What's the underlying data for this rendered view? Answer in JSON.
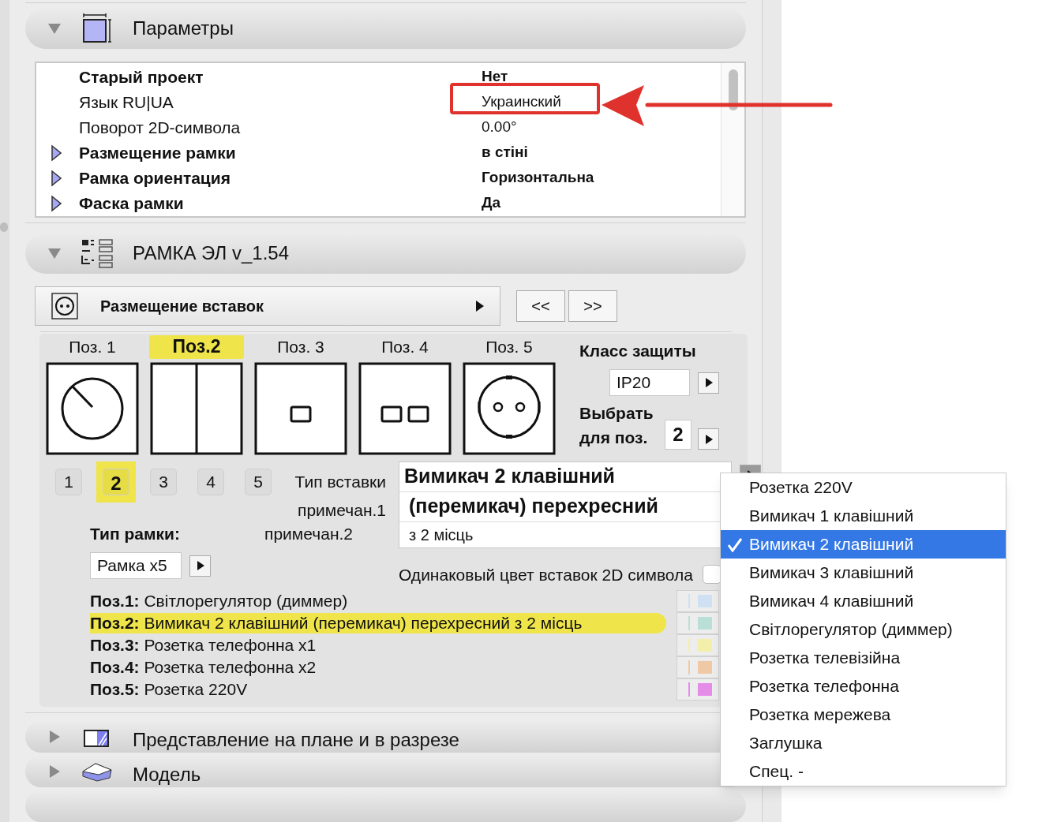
{
  "parameters_panel": {
    "title": "Параметры",
    "expanded": true,
    "rows": [
      {
        "label": "Старый проект",
        "value": "Нет",
        "bold": true,
        "expandable": false,
        "annotated": false
      },
      {
        "label": "Язык RU|UA",
        "value": "Украинский",
        "bold": false,
        "expandable": false,
        "annotated": true
      },
      {
        "label": "Поворот 2D-символа",
        "value": "0.00°",
        "bold": false,
        "expandable": false,
        "annotated": false
      },
      {
        "label": "Размещение рамки",
        "value": "в стіні",
        "bold": true,
        "expandable": true,
        "annotated": false
      },
      {
        "label": "Рамка ориентация",
        "value": "Горизонтальна",
        "bold": true,
        "expandable": true,
        "annotated": false
      },
      {
        "label": "Фаска рамки",
        "value": "Да",
        "bold": true,
        "expandable": true,
        "annotated": false
      }
    ]
  },
  "frame_panel": {
    "title": "РАМКА ЭЛ v_1.54",
    "expanded": true,
    "page_selector": {
      "label": "Размещение вставок"
    },
    "nav_buttons": [
      "<<",
      ">>"
    ],
    "positions": [
      {
        "label": "Поз. 1",
        "selected": false,
        "kind": "dimmer"
      },
      {
        "label": "Поз.2",
        "selected": true,
        "kind": "split"
      },
      {
        "label": "Поз. 3",
        "selected": false,
        "kind": "square"
      },
      {
        "label": "Поз. 4",
        "selected": false,
        "kind": "double-square"
      },
      {
        "label": "Поз. 5",
        "selected": false,
        "kind": "socket"
      }
    ],
    "protection": {
      "label": "Класс защиты",
      "value": "IP20"
    },
    "select_for": {
      "label": "Выбрать для поз.",
      "value": "2"
    },
    "number_buttons": [
      {
        "label": "1",
        "selected": false
      },
      {
        "label": "2",
        "selected": true
      },
      {
        "label": "3",
        "selected": false
      },
      {
        "label": "4",
        "selected": false
      },
      {
        "label": "5",
        "selected": false
      }
    ],
    "insert_type": {
      "label": "Тип вставки",
      "value": "Вимикач 2 клавішний"
    },
    "note1": {
      "label": "примечан.1",
      "value": "(перемикач) перехресний"
    },
    "note2": {
      "label": "примечан.2",
      "value": "з 2 місць"
    },
    "frame_type": {
      "label": "Тип рамки:",
      "value": "Рамка x5"
    },
    "same_color": {
      "label": "Одинаковый цвет вставок 2D символа",
      "checked": false
    },
    "summary": [
      {
        "label": "Поз.1:",
        "text": "Світлорегулятор (диммер)",
        "selected": false,
        "color": "#cfe0f3"
      },
      {
        "label": "Поз.2:",
        "text": "Вимикач 2 клавішний (перемикач) перехресний з 2 місць",
        "selected": true,
        "color": "#b9dfd6"
      },
      {
        "label": "Поз.3:",
        "text": "Розетка телефонна x1",
        "selected": false,
        "color": "#f3efaa"
      },
      {
        "label": "Поз.4:",
        "text": "Розетка телефонна x2",
        "selected": false,
        "color": "#efc9a6"
      },
      {
        "label": "Поз.5:",
        "text": "Розетка 220V",
        "selected": false,
        "color": "#e58be8"
      }
    ]
  },
  "collapsed_panels": [
    {
      "title": "Представление на плане и в разрезе",
      "expanded": false,
      "kind": "plan"
    },
    {
      "title": "Модель",
      "expanded": false,
      "kind": "model"
    }
  ],
  "dropdown": {
    "items": [
      {
        "label": "Розетка 220V",
        "selected": false
      },
      {
        "label": "Вимикач 1 клавішний",
        "selected": false
      },
      {
        "label": "Вимикач 2 клавішний",
        "selected": true
      },
      {
        "label": "Вимикач 3 клавішний",
        "selected": false
      },
      {
        "label": "Вимикач 4 клавішний",
        "selected": false
      },
      {
        "label": "Світлорегулятор (диммер)",
        "selected": false
      },
      {
        "label": "Розетка телевізійна",
        "selected": false
      },
      {
        "label": "Розетка телефонна",
        "selected": false
      },
      {
        "label": "Розетка мережева",
        "selected": false
      },
      {
        "label": "Заглушка",
        "selected": false
      },
      {
        "label": "Спец. -",
        "selected": false
      }
    ]
  }
}
